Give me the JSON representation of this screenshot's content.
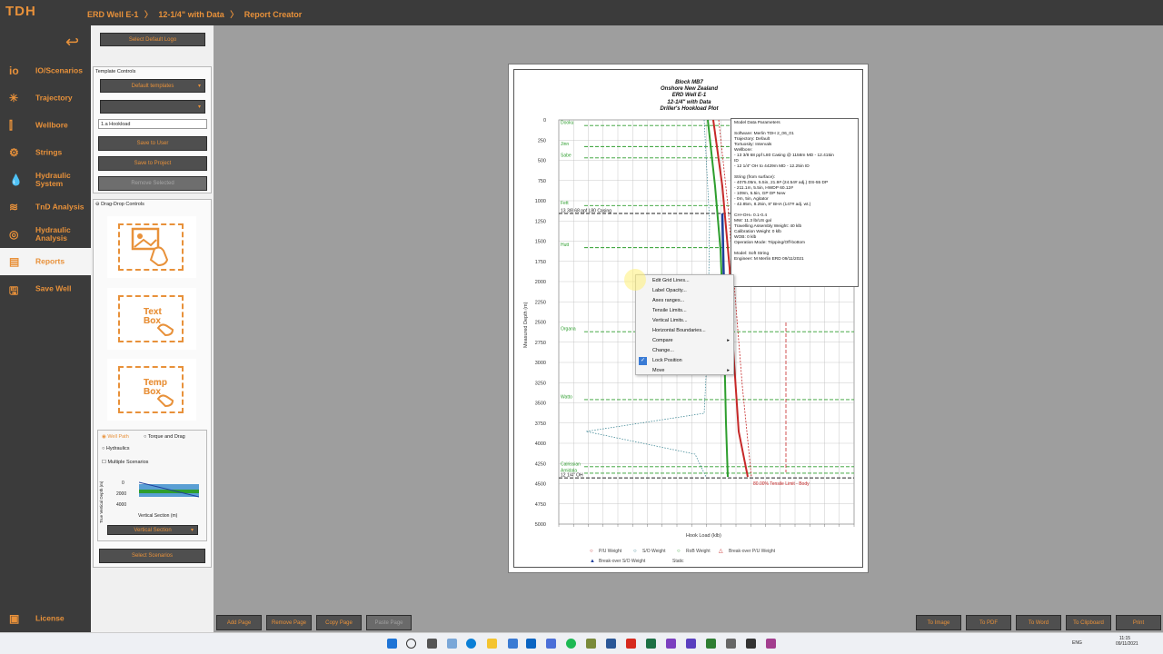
{
  "app": {
    "logo": "TDH",
    "breadcrumbs": [
      "ERD Well E-1",
      "〉",
      "12-1/4\" with Data",
      "〉",
      "Report Creator"
    ]
  },
  "sidebar": {
    "items": [
      {
        "label": "IO/Scenarios",
        "icon": "io-icon"
      },
      {
        "label": "Trajectory",
        "icon": "trajectory-icon"
      },
      {
        "label": "Wellbore",
        "icon": "wellbore-icon"
      },
      {
        "label": "Strings",
        "icon": "strings-icon"
      },
      {
        "label": "Hydraulic System",
        "icon": "hydraulic-icon"
      },
      {
        "label": "TnD Analysis",
        "icon": "tnd-icon"
      },
      {
        "label": "Hydraulic Analysis",
        "icon": "hydraulic-analysis-icon"
      },
      {
        "label": "Reports",
        "icon": "reports-icon"
      },
      {
        "label": "Save Well",
        "icon": "save-icon"
      }
    ],
    "license": "License"
  },
  "panel": {
    "select_logo": "Select Default Logo",
    "template_controls": "Template Controls",
    "default_templates": "Default templates",
    "template_name": "1.a Hookload",
    "save_user": "Save to User",
    "save_project": "Save to Project",
    "remove_selected": "Remove Selected",
    "drag_drop": "Drag-Drop Controls",
    "text_box": "Text Box",
    "temp_box": "Temp Box",
    "radio_wellpath": "Well Path",
    "radio_torque": "Torque and Drag",
    "radio_hydraulics": "Hydraulics",
    "multiple_scenarios": "Multiple Scenarios",
    "mini_ylabel": "True Vertical Depth (m)",
    "mini_yticks": [
      "0",
      "2000",
      "4000"
    ],
    "mini_xlabel": "Vertical Section (m)",
    "vertical_section": "Vertical Section",
    "select_scenarios": "Select Scenarios"
  },
  "chart": {
    "title_lines": [
      "Block MB7",
      "Onshore New Zealand",
      "ERD Well E-1",
      "12-1/4\" with Data",
      "Driller's Hookload Plot"
    ],
    "ylabel": "Measured Depth (m)",
    "xlabel": "Hook Load (klb)",
    "formations": [
      "Dooku",
      "Jinn",
      "Sabe",
      "Fett",
      "13 3/8 68 ppf L80 Casing",
      "Hutt",
      "Organa",
      "Watto",
      "Calrissian",
      "Amidala",
      "12 1/4\" OH"
    ],
    "tensile_label": "80.00% Tensile Limit - Body",
    "legend": [
      "P/U Weight",
      "S/O Weight",
      "RoB Weight",
      "Break-over P/U Weight",
      "Break-over S/O Weight",
      "Static"
    ],
    "params_lines": [
      "Model Data Parameters",
      "",
      "Software: Merlin TDH 2_06_01",
      "Trajectory: Default",
      "Tortuosity: Intervals",
      "Wellbore:",
      " - 13 3/8 68 ppf L80 Casing  @ 1158m MD - 12.415in",
      "ID",
      " - 12 1/4\" OH to 4429m MD - 12.25in ID",
      "",
      "String (from surface):",
      " - 4075.05m, 5.5in, 21.9# (24.54# adj.) DS-55 DP",
      " - 211.1m, 5.5in, HWDP 60.12#",
      " - 109m, 5.5in, GP DP New",
      " - 0m, 5in, Agitator",
      " - 42.85m, 8.25in, 8\" BHA (147# adj. wt.)",
      "",
      "CH+OH= 0.1-0.4",
      "MW: 11.3 lb/US gal",
      "Travelling Assembly Weight: 40 klb",
      "Calibration Weight: 0 klb",
      "WOB: 0 klb",
      "Operation Mode: Tripping/Off-bottom",
      "",
      "Model: Soft String",
      "Engineer: M Merlin ERD 09/11/2021"
    ]
  },
  "chart_data": {
    "type": "line",
    "title": "Block MB7 Onshore New Zealand ERD Well E-1 12-1/4\" with Data Driller's Hookload Plot",
    "xlabel": "Hook Load (klb)",
    "ylabel": "Measured Depth (m)",
    "yticks": [
      0,
      250,
      500,
      750,
      1000,
      1250,
      1500,
      1750,
      2000,
      2250,
      2500,
      2750,
      3000,
      3250,
      3500,
      3750,
      4000,
      4250,
      4500,
      4750,
      5000
    ],
    "ylim": [
      0,
      5000
    ],
    "formation_depths": [
      {
        "name": "Dooku",
        "md": 70
      },
      {
        "name": "Jinn",
        "md": 330
      },
      {
        "name": "Sabe",
        "md": 470
      },
      {
        "name": "Fett",
        "md": 1060
      },
      {
        "name": "13 3/8 68 ppf L80 Casing",
        "md": 1158
      },
      {
        "name": "Hutt",
        "md": 1580
      },
      {
        "name": "Organa",
        "md": 2620
      },
      {
        "name": "Watto",
        "md": 3460
      },
      {
        "name": "Calrissian",
        "md": 4290
      },
      {
        "name": "Amidala",
        "md": 4370
      },
      {
        "name": "12 1/4\" OH",
        "md": 4429
      }
    ],
    "series": [
      {
        "name": "P/U Weight",
        "color": "#c62828"
      },
      {
        "name": "S/O Weight",
        "color": "#2e7d8c"
      },
      {
        "name": "RoB Weight",
        "color": "#2e9e2e"
      },
      {
        "name": "Break-over P/U Weight",
        "color": "#c62828"
      },
      {
        "name": "Break-over S/O Weight",
        "color": "#1f3f9c"
      },
      {
        "name": "Static",
        "color": "#6a2fb0"
      }
    ],
    "grid": true
  },
  "context_menu": {
    "items": [
      {
        "label": "Edit Grid Lines...",
        "sub": false
      },
      {
        "label": "Label Opacity...",
        "sub": false
      },
      {
        "label": "Axes ranges...",
        "sub": false
      },
      {
        "label": "Tensile Limits...",
        "sub": false
      },
      {
        "label": "Vertical Limits...",
        "sub": false
      },
      {
        "label": "Horizontal Boundaries...",
        "sub": false
      },
      {
        "label": "Compare",
        "sub": true
      },
      {
        "label": "Change...",
        "sub": false
      },
      {
        "label": "Lock Position",
        "sub": false,
        "checked": true
      },
      {
        "label": "Move",
        "sub": true
      }
    ]
  },
  "footer": {
    "add_page": "Add Page",
    "remove_page": "Remove Page",
    "copy_page": "Copy Page",
    "paste_page": "Paste Page",
    "to_image": "To Image",
    "to_pdf": "To PDF",
    "to_word": "To Word",
    "to_clipboard": "To Clipboard",
    "print": "Print"
  },
  "taskbar": {
    "lang": "ENG",
    "time": "11:15",
    "date": "09/11/2021"
  },
  "colors": {
    "accent": "#e8913a",
    "dark": "#3b3b3b"
  }
}
